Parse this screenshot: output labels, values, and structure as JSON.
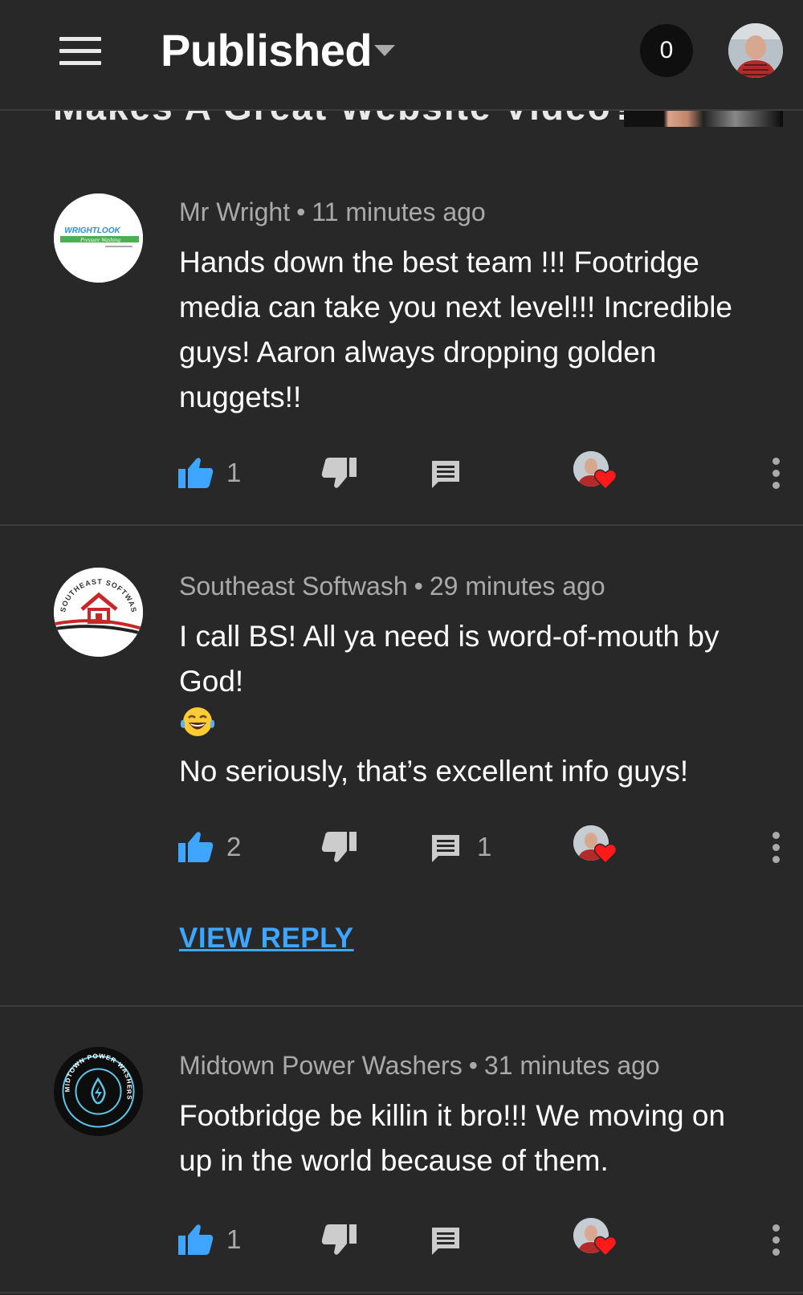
{
  "header": {
    "title": "Published",
    "notification_count": "0"
  },
  "video_peek": {
    "title_fragment": "Makes A Great Website Video?"
  },
  "comments": [
    {
      "author": "Mr Wright",
      "time": "11 minutes ago",
      "text": "Hands down the best team !!! Footridge media can take you next level!!! Incredible guys! Aaron always dropping golden nuggets!!",
      "likes": "1",
      "replies": ""
    },
    {
      "author": "Southeast Softwash",
      "time": "29 minutes ago",
      "text_line1": "I call BS! All ya need is word-of-mouth by God!",
      "emoji": "😂",
      "text_line2": "No seriously, that’s excellent info guys!",
      "likes": "2",
      "replies": "1",
      "view_reply_label": "VIEW REPLY"
    },
    {
      "author": "Midtown Power Washers",
      "time": "31 minutes ago",
      "text": "Footbridge be killin it bro!!! We moving on up in the world because of them.",
      "likes": "1",
      "replies": ""
    }
  ],
  "avatars": {
    "c0_logo_top": "WRIGHTLOOK",
    "c0_logo_bottom": "Pressure Washing",
    "c1_ring_text": "SOUTHEAST SOFTWASH",
    "c2_ring_text": "MIDTOWN POWER WASHERS"
  },
  "colors": {
    "background": "#282828",
    "like_blue": "#3ea6ff",
    "heart_red": "#ff0000",
    "meta_gray": "#aaaaaa"
  },
  "icons": [
    "menu-icon",
    "dropdown-icon",
    "thumbs-up-icon",
    "thumbs-down-icon",
    "reply-icon",
    "heart-icon",
    "more-vert-icon"
  ]
}
